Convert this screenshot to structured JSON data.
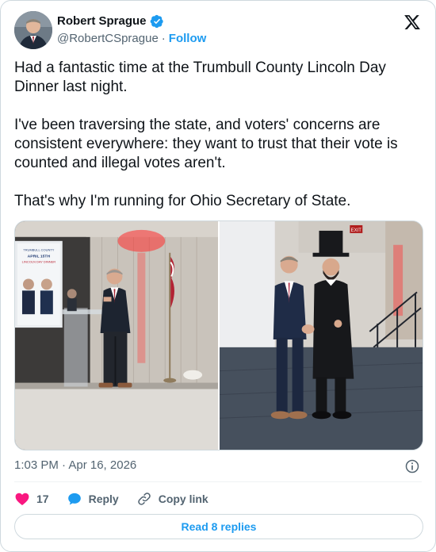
{
  "author": {
    "name": "Robert Sprague",
    "handle": "@RobertCSprague",
    "separator": "·",
    "follow_label": "Follow"
  },
  "tweet": {
    "paragraphs": [
      "Had a fantastic time at the Trumbull County Lincoln Day Dinner last night.",
      "I've been traversing the state, and voters' concerns are consistent everywhere: they want to trust that their vote is counted and illegal votes aren't.",
      "That's why I'm running for Ohio Secretary of State."
    ],
    "timestamp": "1:03 PM · Apr 16, 2026"
  },
  "media": {
    "slide_lines": [
      "TRUMBULL COUNTY",
      "APRIL 15TH",
      "LINCOLN DAY DINNER"
    ],
    "exit_sign": "EXIT"
  },
  "actions": {
    "like_count": "17",
    "reply_label": "Reply",
    "copy_link_label": "Copy link"
  },
  "read_replies_label": "Read 8 replies",
  "colors": {
    "accent": "#1d9bf0",
    "like": "#f91880",
    "text": "#0f1419",
    "muted": "#536471"
  }
}
